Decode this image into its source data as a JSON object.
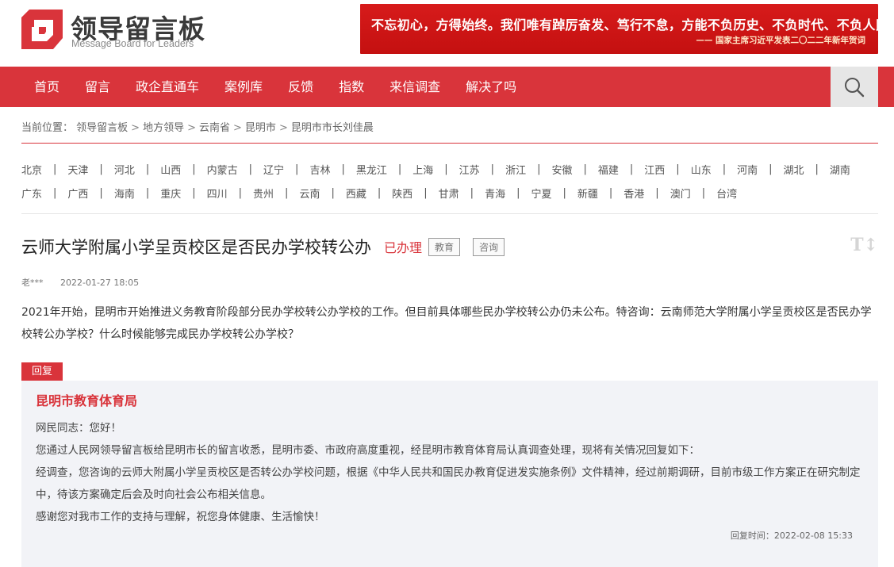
{
  "header": {
    "logo_title": "领导留言板",
    "logo_subtitle": "Message Board for Leaders",
    "banner_main": "不忘初心，方得始终。我们唯有踔厉奋发、笃行不怠，方能不负历史、不负时代、不负人民。",
    "banner_sub": "—— 国家主席习近平发表二〇二二年新年贺词"
  },
  "nav": {
    "items": [
      "首页",
      "留言",
      "政企直通车",
      "案例库",
      "反馈",
      "指数",
      "来信调查",
      "解决了吗"
    ],
    "search_icon": "search-icon"
  },
  "breadcrumb": {
    "prefix": "当前位置：",
    "items": [
      "领导留言板",
      "地方领导",
      "云南省",
      "昆明市",
      "昆明市市长刘佳晨"
    ],
    "separator": ">"
  },
  "provinces": {
    "row1": [
      "北京",
      "天津",
      "河北",
      "山西",
      "内蒙古",
      "辽宁",
      "吉林",
      "黑龙江",
      "上海",
      "江苏",
      "浙江",
      "安徽",
      "福建",
      "江西",
      "山东",
      "河南",
      "湖北",
      "湖南"
    ],
    "row2": [
      "广东",
      "广西",
      "海南",
      "重庆",
      "四川",
      "贵州",
      "云南",
      "西藏",
      "陕西",
      "甘肃",
      "青海",
      "宁夏",
      "新疆",
      "香港",
      "澳门",
      "台湾"
    ]
  },
  "message": {
    "title": "云师大学附属小学呈贡校区是否民办学校转公办",
    "status": "已办理",
    "tags": [
      "教育",
      "咨询"
    ],
    "font_toggle": "T↕",
    "author": "老***",
    "date": "2022-01-27 18:05",
    "content": "2021年开始，昆明市开始推进义务教育阶段部分民办学校转公办学校的工作。但目前具体哪些民办学校转公办仍未公布。特咨询：云南师范大学附属小学呈贡校区是否民办学校转公办学校？什么时候能够完成民办学校转公办学校？"
  },
  "reply": {
    "label": "回复",
    "org": "昆明市教育体育局",
    "paragraphs": [
      "网民同志：您好！",
      "您通过人民网领导留言板给昆明市长的留言收悉，昆明市委、市政府高度重视，经昆明市教育体育局认真调查处理，现将有关情况回复如下：",
      "经调查，您咨询的云师大附属小学呈贡校区是否转公办学校问题，根据《中华人民共和国民办教育促进发实施条例》文件精神，经过前期调研，目前市级工作方案正在研究制定中，待该方案确定后会及时向社会公布相关信息。",
      "感谢您对我市工作的支持与理解，祝您身体健康、生活愉快！"
    ],
    "time_label": "回复时间：",
    "time": "2022-02-08 15:33"
  },
  "colors": {
    "brand_red": "#d9343b",
    "banner_red": "#c41010",
    "reply_bg": "#f2f3f7"
  }
}
